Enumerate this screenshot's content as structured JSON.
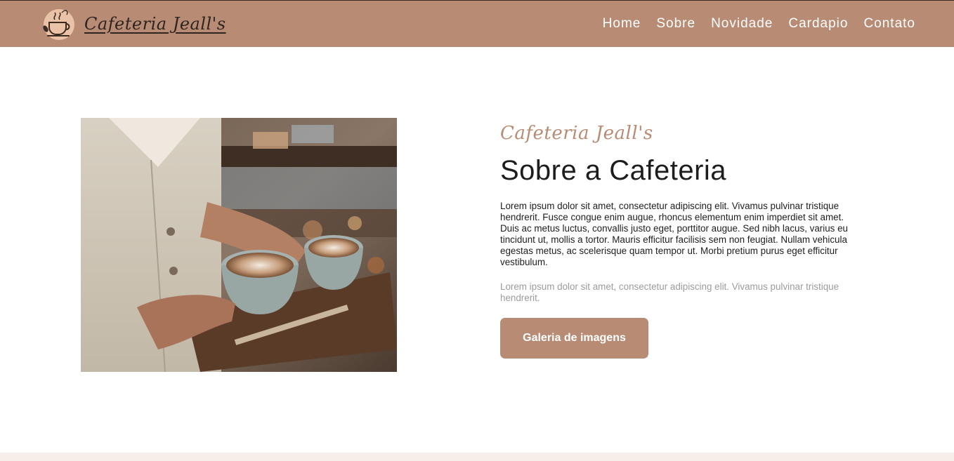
{
  "brand": {
    "name": "Cafeteria Jeall's",
    "logo_icon": "coffee-cup-icon"
  },
  "nav": {
    "items": [
      "Home",
      "Sobre",
      "Novidade",
      "Cardapio",
      "Contato"
    ]
  },
  "about": {
    "script_title": "Cafeteria Jeall's",
    "heading": "Sobre a Cafeteria",
    "paragraph_1": "Lorem ipsum dolor sit amet, consectetur adipiscing elit. Vivamus pulvinar tristique hendrerit. Fusce congue enim augue, rhoncus elementum enim imperdiet sit amet. Duis ac metus luctus, convallis justo eget, porttitor augue. Sed nibh lacus, varius eu tincidunt ut, mollis a tortor. Mauris efficitur facilisis sem non feugiat. Nullam vehicula egestas metus, ac scelerisque quam tempor ut. Morbi pretium purus eget efficitur vestibulum.",
    "paragraph_2": "Lorem ipsum dolor sit amet, consectetur adipiscing elit. Vivamus pulvinar tristique hendrerit.",
    "button_label": "Galeria de imagens",
    "image_icon": "barista-coffee-photo"
  },
  "colors": {
    "brand": "#b88c74",
    "footer_band": "#f6eee8",
    "muted_text": "#9b9b9b"
  }
}
